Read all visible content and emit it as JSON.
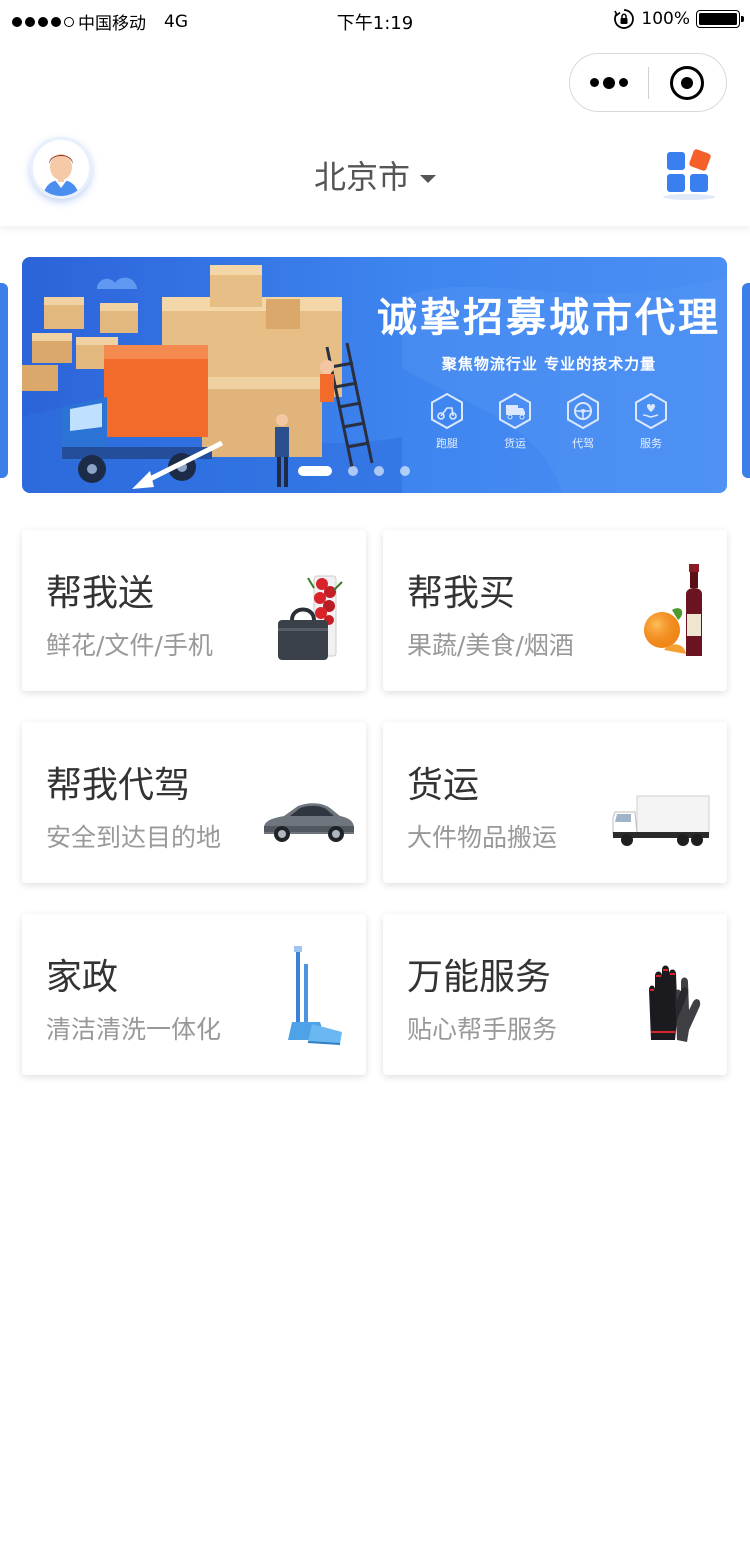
{
  "status_bar": {
    "carrier": "中国移动",
    "network": "4G",
    "time": "下午1:19",
    "battery": "100%",
    "lock_icon": "rotation-lock-icon"
  },
  "capsule": {
    "more_icon": "more-dots-icon",
    "close_icon": "target-close-icon"
  },
  "header": {
    "city": "北京市",
    "avatar_icon": "user-avatar-icon",
    "apps_icon": "apps-grid-icon"
  },
  "banner": {
    "title": "诚挚招募城市代理",
    "subtitle": "聚焦物流行业  专业的技术力量",
    "icons": [
      {
        "label": "跑腿",
        "icon": "scooter-icon"
      },
      {
        "label": "货运",
        "icon": "truck-icon"
      },
      {
        "label": "代驾",
        "icon": "steering-wheel-icon"
      },
      {
        "label": "服务",
        "icon": "heart-hand-icon"
      }
    ],
    "slide_count": 4,
    "active_slide": 1,
    "colors": {
      "primary": "#2b63d9",
      "accent": "#f26b2a"
    }
  },
  "services": [
    {
      "title": "帮我送",
      "subtitle": "鲜花/文件/手机",
      "icon": "flowers-bag-image"
    },
    {
      "title": "帮我买",
      "subtitle": "果蔬/美食/烟酒",
      "icon": "wine-orange-image"
    },
    {
      "title": "帮我代驾",
      "subtitle": "安全到达目的地",
      "icon": "car-image"
    },
    {
      "title": "货运",
      "subtitle": "大件物品搬运",
      "icon": "box-truck-image"
    },
    {
      "title": "家政",
      "subtitle": "清洁清洗一体化",
      "icon": "broom-dustpan-image"
    },
    {
      "title": "万能服务",
      "subtitle": "贴心帮手服务",
      "icon": "gloves-image"
    }
  ]
}
